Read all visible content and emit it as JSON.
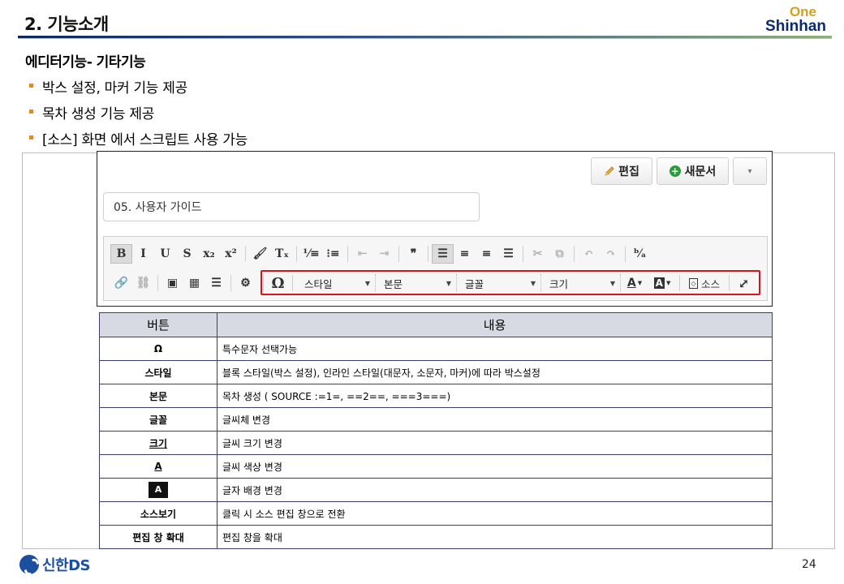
{
  "header": {
    "title": "2. 기능소개",
    "logo_top": "One",
    "logo_bottom": "Shinhan",
    "colors": {
      "rule_dark": "#0b2a5b",
      "rule_light": "#8fb07a",
      "logo_gold": "#d4a017",
      "logo_navy": "#0b2a6b"
    }
  },
  "section": {
    "title": "에디터기능- 기타기능",
    "bullets": [
      "박스 설정, 마커 기능 제공",
      "목차 생성 기능 제공",
      "[소스] 화면 에서 스크립트 사용 가능"
    ],
    "bullet_color": "#e08a1e"
  },
  "editor": {
    "edit_button": "편집",
    "new_doc_button": "새문서",
    "more_button": "▾",
    "title_value": "05. 사용자 가이드",
    "toolbar_row1": [
      {
        "name": "bold-button",
        "glyph": "B",
        "active": true
      },
      {
        "name": "italic-button",
        "glyph": "I"
      },
      {
        "name": "underline-button",
        "glyph": "U"
      },
      {
        "name": "strike-button",
        "glyph": "S"
      },
      {
        "name": "subscript-button",
        "glyph": "x₂"
      },
      {
        "name": "superscript-button",
        "glyph": "x²"
      },
      {
        "name": "sep"
      },
      {
        "name": "format-painter-button",
        "glyph": "🖌"
      },
      {
        "name": "clear-format-button",
        "glyph": "Tₓ"
      },
      {
        "name": "sep"
      },
      {
        "name": "numbered-list-button",
        "glyph": "⅟≡"
      },
      {
        "name": "bulleted-list-button",
        "glyph": "⁝≡"
      },
      {
        "name": "sep"
      },
      {
        "name": "outdent-button",
        "glyph": "⇤",
        "dim": true
      },
      {
        "name": "indent-button",
        "glyph": "⇥",
        "dim": true
      },
      {
        "name": "sep"
      },
      {
        "name": "blockquote-button",
        "glyph": "❞"
      },
      {
        "name": "sep"
      },
      {
        "name": "align-left-button",
        "glyph": "☰",
        "active": true
      },
      {
        "name": "align-center-button",
        "glyph": "≡"
      },
      {
        "name": "align-right-button",
        "glyph": "≡"
      },
      {
        "name": "align-justify-button",
        "glyph": "☰"
      },
      {
        "name": "sep"
      },
      {
        "name": "cut-button",
        "glyph": "✂",
        "dim": true
      },
      {
        "name": "copy-button",
        "glyph": "⧉",
        "dim": true
      },
      {
        "name": "sep"
      },
      {
        "name": "undo-button",
        "glyph": "↶",
        "dim": true
      },
      {
        "name": "redo-button",
        "glyph": "↷",
        "dim": true
      },
      {
        "name": "sep"
      },
      {
        "name": "find-replace-button",
        "glyph": "ᵇ⁄ₐ"
      }
    ],
    "toolbar_row2_left": [
      {
        "name": "link-button",
        "glyph": "🔗"
      },
      {
        "name": "unlink-button",
        "glyph": "⛓",
        "dim": true
      },
      {
        "name": "sep"
      },
      {
        "name": "image-button",
        "glyph": "▣"
      },
      {
        "name": "table-button",
        "glyph": "▦"
      },
      {
        "name": "horizontal-line-button",
        "glyph": "☰"
      },
      {
        "name": "sep"
      },
      {
        "name": "settings-button",
        "glyph": "⚙"
      }
    ],
    "special_char": "Ω",
    "combo_style": "스타일",
    "combo_format": "본문",
    "combo_font": "글꼴",
    "combo_size": "크기",
    "text_color": "A",
    "bg_color": "A",
    "source_button": "소스",
    "maximize_glyph": "⤢",
    "highlight_color": "#d8141a"
  },
  "table": {
    "headers": [
      "버튼",
      "내용"
    ],
    "rows": [
      {
        "button": "Ω",
        "desc": "특수문자 선택가능"
      },
      {
        "button": "스타일",
        "desc": "블록 스타일(박스 설정), 인라인 스타일(대문자,  소문자, 마커)에 따라 박스설정"
      },
      {
        "button": "본문",
        "desc": "목차 생성 ( SOURCE :=1=, ==2==, ===3===)"
      },
      {
        "button": "글꼴",
        "desc": "글씨체 변경"
      },
      {
        "button": "크기",
        "desc": "글씨 크기 변경",
        "style": "underline"
      },
      {
        "button": "A",
        "desc": "글씨 색상 변경",
        "style": "underline"
      },
      {
        "button": "A",
        "desc": "글자 배경 변경",
        "style": "black"
      },
      {
        "button": "소스보기",
        "desc": "클릭 시 소스 편집 창으로 전환"
      },
      {
        "button": "편집 창 확대",
        "desc": "편집 창을 확대"
      }
    ],
    "header_bg": "#d7dae3",
    "border_color": "#3a3f6a"
  },
  "footer": {
    "company": "신한DS",
    "page": "24"
  }
}
